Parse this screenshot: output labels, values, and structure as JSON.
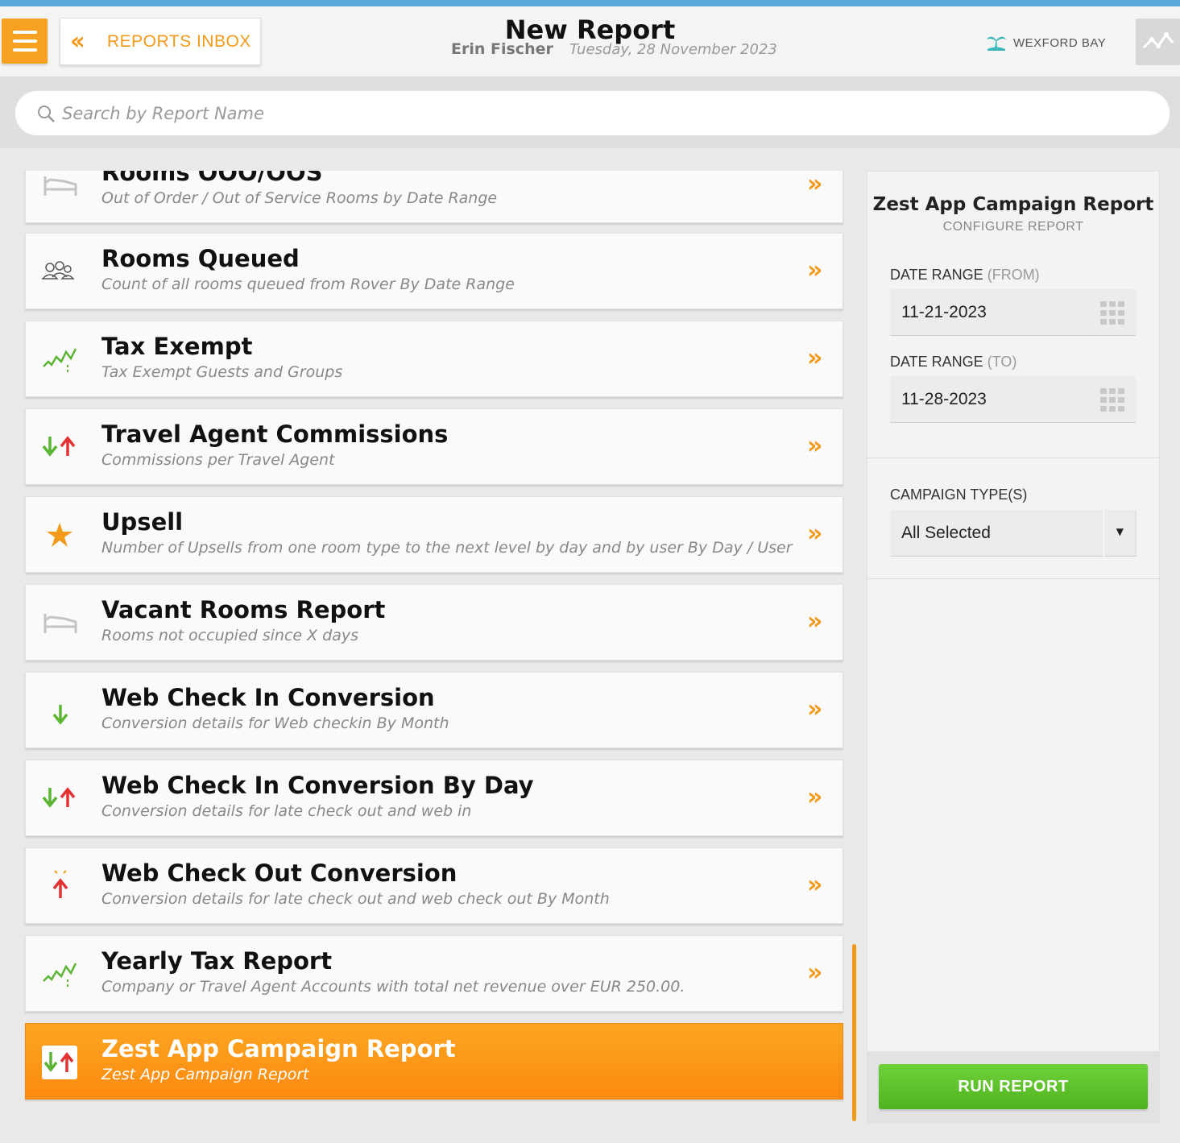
{
  "header": {
    "title": "New Report",
    "user_name": "Erin Fischer",
    "date": "Tuesday, 28 November 2023",
    "back_button_label": "REPORTS INBOX",
    "hotel_name": "WEXFORD BAY"
  },
  "search": {
    "placeholder": "Search by Report Name"
  },
  "reports": [
    {
      "title": "Rooms OOO/OOS",
      "description": "Out of Order / Out of Service Rooms by Date Range",
      "icon": "bed-icon"
    },
    {
      "title": "Rooms Queued",
      "description": "Count of all rooms queued from Rover By Date Range",
      "icon": "guests-icon"
    },
    {
      "title": "Tax Exempt",
      "description": "Tax Exempt Guests and Groups",
      "icon": "trend-icon"
    },
    {
      "title": "Travel Agent Commissions",
      "description": "Commissions per Travel Agent",
      "icon": "arrows-up-down-icon"
    },
    {
      "title": "Upsell",
      "description": "Number of Upsells from one room type to the next level by day and by user By Day / User",
      "icon": "star-icon"
    },
    {
      "title": "Vacant Rooms Report",
      "description": "Rooms not occupied since X days",
      "icon": "bed-icon"
    },
    {
      "title": "Web Check In Conversion",
      "description": "Conversion details for Web checkin By Month",
      "icon": "arrow-down-icon"
    },
    {
      "title": "Web Check In Conversion By Day",
      "description": "Conversion details for late check out and web in",
      "icon": "arrows-up-down-icon"
    },
    {
      "title": "Web Check Out Conversion",
      "description": "Conversion details for late check out and web check out By Month",
      "icon": "arrow-up-icon"
    },
    {
      "title": "Yearly Tax Report",
      "description": "Company or Travel Agent Accounts with total net revenue over EUR 250.00.",
      "icon": "trend-icon"
    },
    {
      "title": "Zest App Campaign Report",
      "description": "Zest App Campaign Report",
      "icon": "arrows-up-down-icon",
      "selected": true
    }
  ],
  "panel": {
    "title": "Zest App Campaign Report",
    "subtitle": "CONFIGURE REPORT",
    "date_from_label": "DATE RANGE",
    "date_from_hint": "(FROM)",
    "date_from_value": "11-21-2023",
    "date_to_label": "DATE RANGE",
    "date_to_hint": "(TO)",
    "date_to_value": "11-28-2023",
    "campaign_label": "CAMPAIGN TYPE(S)",
    "campaign_value": "All Selected",
    "run_label": "RUN REPORT"
  },
  "colors": {
    "accent": "#f39a1b",
    "run_button": "#5cc229",
    "top_line": "#5aa7d9"
  }
}
